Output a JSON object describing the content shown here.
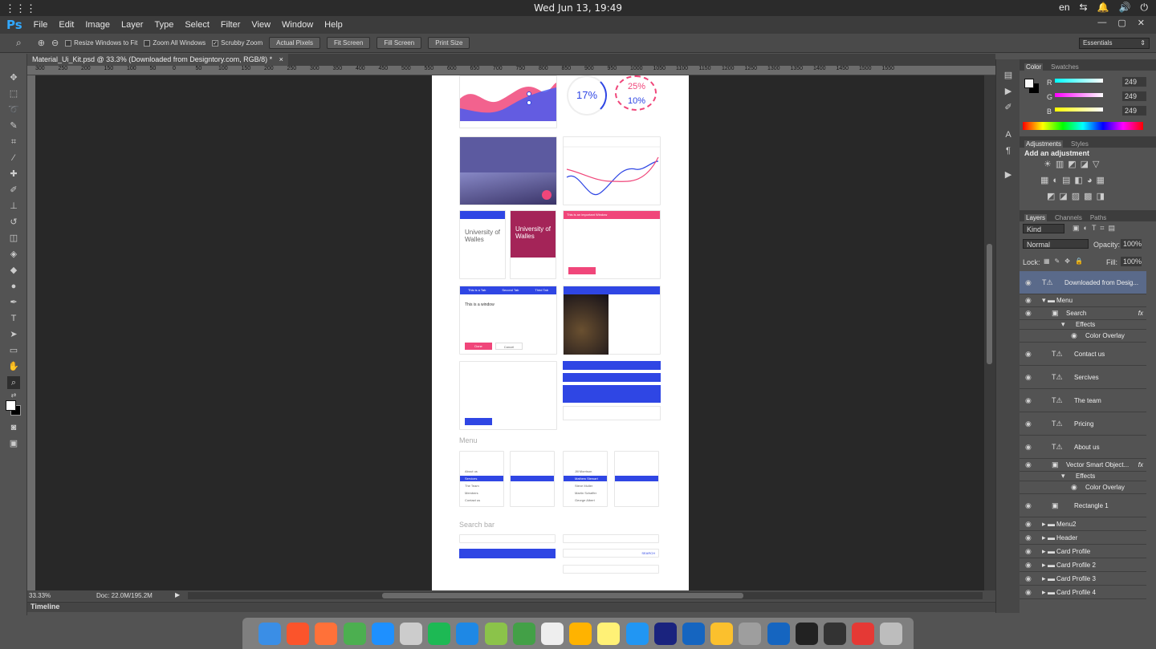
{
  "os": {
    "clock": "Wed Jun 13, 19:49",
    "lang": "en"
  },
  "app": {
    "logo": "Ps",
    "menus": [
      "File",
      "Edit",
      "Image",
      "Layer",
      "Type",
      "Select",
      "Filter",
      "View",
      "Window",
      "Help"
    ]
  },
  "options": {
    "resize_windows": "Resize Windows to Fit",
    "zoom_all": "Zoom All Windows",
    "scrubby": "Scrubby Zoom",
    "actual_pixels": "Actual Pixels",
    "fit_screen": "Fit Screen",
    "fill_screen": "Fill Screen",
    "print_size": "Print Size",
    "workspace": "Essentials"
  },
  "document": {
    "tab_title": "Material_Ui_Kit.psd @ 33.3% (Downloaded from Designtory.com, RGB/8) *",
    "zoom": "33.33%",
    "doc_size": "Doc: 22.0M/195.2M",
    "timeline": "Timeline",
    "ruler_marks": [
      "300",
      "250",
      "200",
      "150",
      "100",
      "50",
      "0",
      "50",
      "100",
      "150",
      "200",
      "250",
      "300",
      "350",
      "400",
      "450",
      "500",
      "550",
      "600",
      "650",
      "700",
      "750",
      "800",
      "850",
      "900",
      "950",
      "1000",
      "1050",
      "1100",
      "1150",
      "1200",
      "1250",
      "1300",
      "1350",
      "1400",
      "1450",
      "1500",
      "1550"
    ]
  },
  "artboard": {
    "stat1": "17%",
    "stat2": "25%",
    "stat3": "10%",
    "univ1": "University of Walles",
    "univ2": "University of Walles",
    "important": "This is an important Window",
    "tab_a": "This is a Tab",
    "tab_b": "Second Tab",
    "tab_c": "Third Tab",
    "window_title": "This is a window",
    "done": "Done",
    "cancel": "Cancel",
    "menu_section": "Menu",
    "search_section": "Search bar",
    "menu_items": [
      "About us",
      "Services",
      "The Team",
      "Members",
      "Contact us"
    ],
    "users": [
      "Jill Morrison",
      "Mathew Stewart",
      "Steve Muller",
      "Martin Schaffer",
      "George Albert"
    ],
    "search_btn": "SEARCH",
    "click": "Click"
  },
  "color_panel": {
    "tabs": [
      "Color",
      "Swatches"
    ],
    "r_label": "R",
    "g_label": "G",
    "b_label": "B",
    "r": "249",
    "g": "249",
    "b": "249"
  },
  "adjustments": {
    "tabs": [
      "Adjustments",
      "Styles"
    ],
    "add": "Add an adjustment"
  },
  "layers_panel": {
    "tabs": [
      "Layers",
      "Channels",
      "Paths"
    ],
    "kind": "Kind",
    "blend": "Normal",
    "opacity_label": "Opacity:",
    "opacity": "100%",
    "lock_label": "Lock:",
    "fill_label": "Fill:",
    "fill": "100%",
    "layers": [
      {
        "name": "Downloaded from Desig...",
        "kind": "text",
        "indent": 0,
        "selected": true
      },
      {
        "name": "Menu",
        "kind": "group-open",
        "indent": 0
      },
      {
        "name": "Search",
        "kind": "smart",
        "indent": 1,
        "fx": true
      },
      {
        "name": "Effects",
        "kind": "effects",
        "indent": 2
      },
      {
        "name": "Color Overlay",
        "kind": "effect",
        "indent": 3
      },
      {
        "name": "Contact us",
        "kind": "text",
        "indent": 1
      },
      {
        "name": "Sercives",
        "kind": "text",
        "indent": 1
      },
      {
        "name": "The team",
        "kind": "text",
        "indent": 1
      },
      {
        "name": "Pricing",
        "kind": "text",
        "indent": 1
      },
      {
        "name": "About us",
        "kind": "text",
        "indent": 1
      },
      {
        "name": "Vector Smart Object...",
        "kind": "smart",
        "indent": 1,
        "fx": true
      },
      {
        "name": "Effects",
        "kind": "effects",
        "indent": 2
      },
      {
        "name": "Color Overlay",
        "kind": "effect",
        "indent": 3
      },
      {
        "name": "Rectangle 1",
        "kind": "shape",
        "indent": 1
      },
      {
        "name": "Menu2",
        "kind": "group",
        "indent": 0
      },
      {
        "name": "Header",
        "kind": "group",
        "indent": 0
      },
      {
        "name": "Card Profile",
        "kind": "group",
        "indent": 0
      },
      {
        "name": "Card Profile 2",
        "kind": "group",
        "indent": 0
      },
      {
        "name": "Card Profile 3",
        "kind": "group",
        "indent": 0
      },
      {
        "name": "Card Profile 4",
        "kind": "group",
        "indent": 0
      }
    ]
  },
  "dock_icons": [
    "finder-icon",
    "brave-icon",
    "firefox-icon",
    "chrome-icon",
    "safari-icon",
    "swift-icon",
    "spotify-icon",
    "app-store-icon",
    "hanger-icon",
    "shield-icon",
    "vectorize-icon",
    "preview-icon",
    "notes-icon",
    "mail-icon",
    "photoshop-icon",
    "pen-icon",
    "pinwheel-icon",
    "rocket-icon",
    "kodi-icon",
    "terminal-icon",
    "console-icon",
    "file-icon",
    "trash-icon"
  ],
  "colors": {
    "accent": "#2f46e4",
    "pink": "#f0467a",
    "selected_layer": "#5a6a8a"
  }
}
